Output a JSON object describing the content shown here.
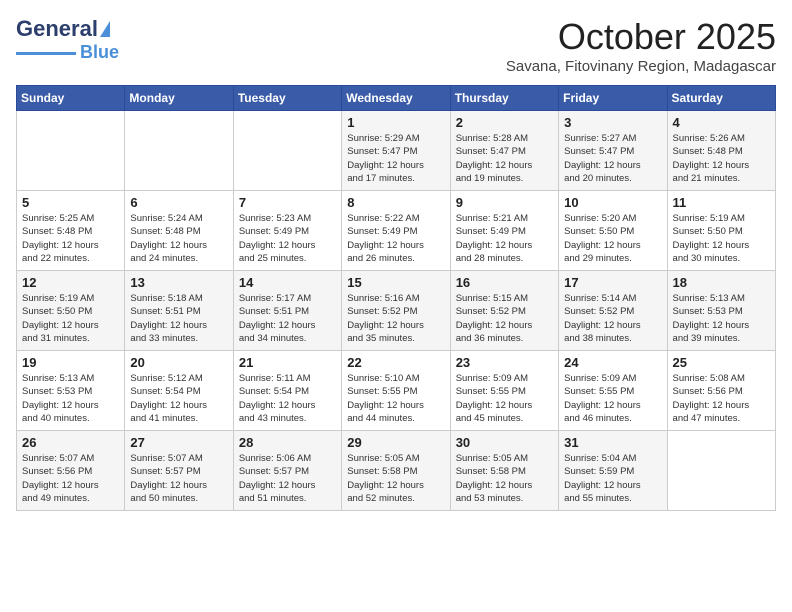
{
  "header": {
    "logo_line1": "General",
    "logo_line2": "Blue",
    "month": "October 2025",
    "location": "Savana, Fitovinany Region, Madagascar"
  },
  "days_of_week": [
    "Sunday",
    "Monday",
    "Tuesday",
    "Wednesday",
    "Thursday",
    "Friday",
    "Saturday"
  ],
  "weeks": [
    [
      {
        "day": "",
        "info": ""
      },
      {
        "day": "",
        "info": ""
      },
      {
        "day": "",
        "info": ""
      },
      {
        "day": "1",
        "info": "Sunrise: 5:29 AM\nSunset: 5:47 PM\nDaylight: 12 hours\nand 17 minutes."
      },
      {
        "day": "2",
        "info": "Sunrise: 5:28 AM\nSunset: 5:47 PM\nDaylight: 12 hours\nand 19 minutes."
      },
      {
        "day": "3",
        "info": "Sunrise: 5:27 AM\nSunset: 5:47 PM\nDaylight: 12 hours\nand 20 minutes."
      },
      {
        "day": "4",
        "info": "Sunrise: 5:26 AM\nSunset: 5:48 PM\nDaylight: 12 hours\nand 21 minutes."
      }
    ],
    [
      {
        "day": "5",
        "info": "Sunrise: 5:25 AM\nSunset: 5:48 PM\nDaylight: 12 hours\nand 22 minutes."
      },
      {
        "day": "6",
        "info": "Sunrise: 5:24 AM\nSunset: 5:48 PM\nDaylight: 12 hours\nand 24 minutes."
      },
      {
        "day": "7",
        "info": "Sunrise: 5:23 AM\nSunset: 5:49 PM\nDaylight: 12 hours\nand 25 minutes."
      },
      {
        "day": "8",
        "info": "Sunrise: 5:22 AM\nSunset: 5:49 PM\nDaylight: 12 hours\nand 26 minutes."
      },
      {
        "day": "9",
        "info": "Sunrise: 5:21 AM\nSunset: 5:49 PM\nDaylight: 12 hours\nand 28 minutes."
      },
      {
        "day": "10",
        "info": "Sunrise: 5:20 AM\nSunset: 5:50 PM\nDaylight: 12 hours\nand 29 minutes."
      },
      {
        "day": "11",
        "info": "Sunrise: 5:19 AM\nSunset: 5:50 PM\nDaylight: 12 hours\nand 30 minutes."
      }
    ],
    [
      {
        "day": "12",
        "info": "Sunrise: 5:19 AM\nSunset: 5:50 PM\nDaylight: 12 hours\nand 31 minutes."
      },
      {
        "day": "13",
        "info": "Sunrise: 5:18 AM\nSunset: 5:51 PM\nDaylight: 12 hours\nand 33 minutes."
      },
      {
        "day": "14",
        "info": "Sunrise: 5:17 AM\nSunset: 5:51 PM\nDaylight: 12 hours\nand 34 minutes."
      },
      {
        "day": "15",
        "info": "Sunrise: 5:16 AM\nSunset: 5:52 PM\nDaylight: 12 hours\nand 35 minutes."
      },
      {
        "day": "16",
        "info": "Sunrise: 5:15 AM\nSunset: 5:52 PM\nDaylight: 12 hours\nand 36 minutes."
      },
      {
        "day": "17",
        "info": "Sunrise: 5:14 AM\nSunset: 5:52 PM\nDaylight: 12 hours\nand 38 minutes."
      },
      {
        "day": "18",
        "info": "Sunrise: 5:13 AM\nSunset: 5:53 PM\nDaylight: 12 hours\nand 39 minutes."
      }
    ],
    [
      {
        "day": "19",
        "info": "Sunrise: 5:13 AM\nSunset: 5:53 PM\nDaylight: 12 hours\nand 40 minutes."
      },
      {
        "day": "20",
        "info": "Sunrise: 5:12 AM\nSunset: 5:54 PM\nDaylight: 12 hours\nand 41 minutes."
      },
      {
        "day": "21",
        "info": "Sunrise: 5:11 AM\nSunset: 5:54 PM\nDaylight: 12 hours\nand 43 minutes."
      },
      {
        "day": "22",
        "info": "Sunrise: 5:10 AM\nSunset: 5:55 PM\nDaylight: 12 hours\nand 44 minutes."
      },
      {
        "day": "23",
        "info": "Sunrise: 5:09 AM\nSunset: 5:55 PM\nDaylight: 12 hours\nand 45 minutes."
      },
      {
        "day": "24",
        "info": "Sunrise: 5:09 AM\nSunset: 5:55 PM\nDaylight: 12 hours\nand 46 minutes."
      },
      {
        "day": "25",
        "info": "Sunrise: 5:08 AM\nSunset: 5:56 PM\nDaylight: 12 hours\nand 47 minutes."
      }
    ],
    [
      {
        "day": "26",
        "info": "Sunrise: 5:07 AM\nSunset: 5:56 PM\nDaylight: 12 hours\nand 49 minutes."
      },
      {
        "day": "27",
        "info": "Sunrise: 5:07 AM\nSunset: 5:57 PM\nDaylight: 12 hours\nand 50 minutes."
      },
      {
        "day": "28",
        "info": "Sunrise: 5:06 AM\nSunset: 5:57 PM\nDaylight: 12 hours\nand 51 minutes."
      },
      {
        "day": "29",
        "info": "Sunrise: 5:05 AM\nSunset: 5:58 PM\nDaylight: 12 hours\nand 52 minutes."
      },
      {
        "day": "30",
        "info": "Sunrise: 5:05 AM\nSunset: 5:58 PM\nDaylight: 12 hours\nand 53 minutes."
      },
      {
        "day": "31",
        "info": "Sunrise: 5:04 AM\nSunset: 5:59 PM\nDaylight: 12 hours\nand 55 minutes."
      },
      {
        "day": "",
        "info": ""
      }
    ]
  ]
}
